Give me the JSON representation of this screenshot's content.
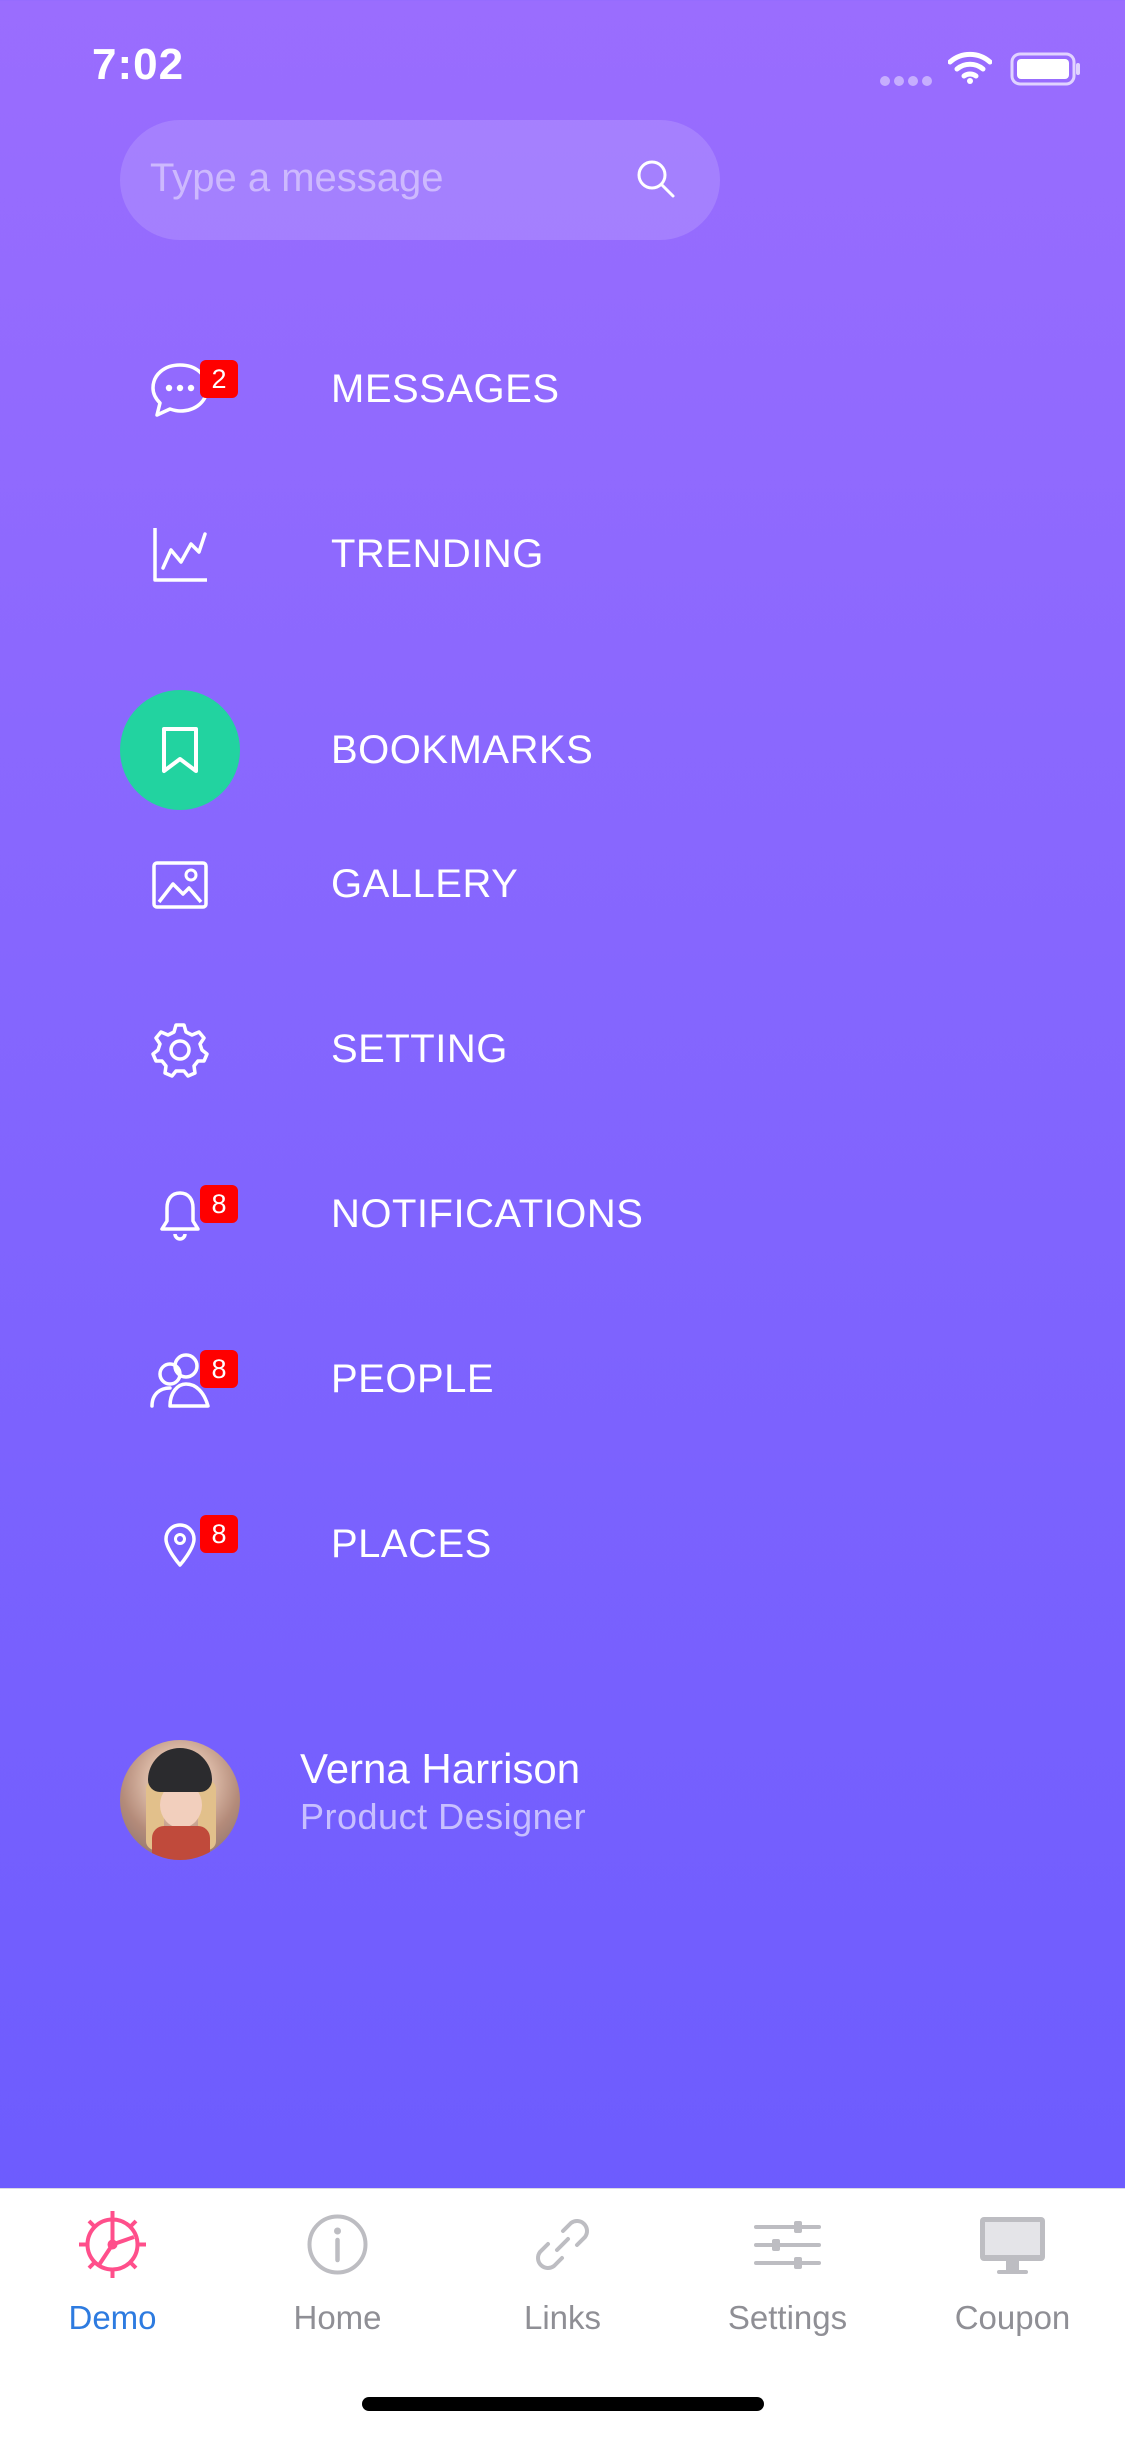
{
  "status_bar": {
    "time": "7:02"
  },
  "search": {
    "placeholder": "Type a message"
  },
  "menu": {
    "items": [
      {
        "label": "MESSAGES",
        "icon": "chat-bubble-icon",
        "badge": "2"
      },
      {
        "label": "TRENDING",
        "icon": "chart-line-icon",
        "badge": ""
      },
      {
        "label": "BOOKMARKS",
        "icon": "bookmark-icon",
        "badge": "",
        "active": true
      },
      {
        "label": "GALLERY",
        "icon": "image-icon",
        "badge": ""
      },
      {
        "label": "SETTING",
        "icon": "gear-icon",
        "badge": ""
      },
      {
        "label": "NOTIFICATIONS",
        "icon": "bell-icon",
        "badge": "8"
      },
      {
        "label": "PEOPLE",
        "icon": "people-icon",
        "badge": "8"
      },
      {
        "label": "PLACES",
        "icon": "map-pin-icon",
        "badge": "8"
      }
    ]
  },
  "profile": {
    "name": "Verna Harrison",
    "role": "Product Designer"
  },
  "tabbar": {
    "tabs": [
      {
        "label": "Demo",
        "icon": "gear-icon",
        "active": true
      },
      {
        "label": "Home",
        "icon": "info-icon"
      },
      {
        "label": "Links",
        "icon": "link-icon"
      },
      {
        "label": "Settings",
        "icon": "sliders-icon"
      },
      {
        "label": "Coupon",
        "icon": "monitor-icon"
      }
    ]
  },
  "colors": {
    "gradient_top": "#9a6dfe",
    "gradient_bottom": "#6d5cfe",
    "active_icon_bg": "#22d3a0",
    "badge": "#ff0000",
    "tab_active": "#2d7be0",
    "tab_active_icon": "#ff4f8b",
    "tab_inactive": "#8f8f95"
  }
}
